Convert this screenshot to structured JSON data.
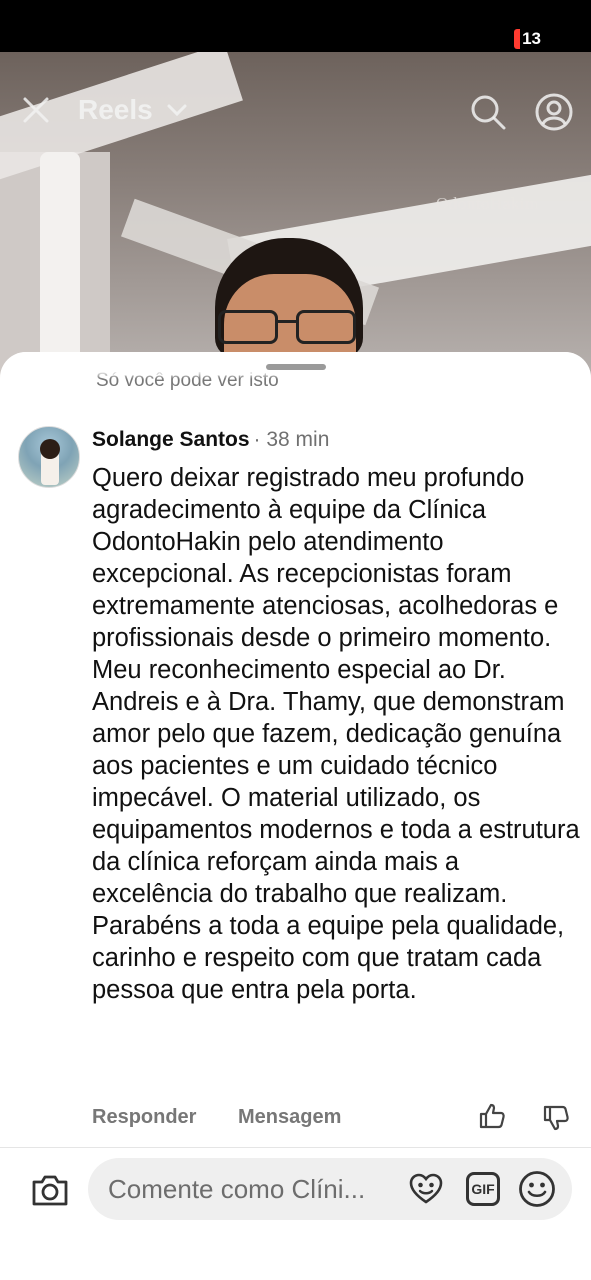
{
  "status_bar": {
    "battery_level": "13",
    "battery_color": "#ff3b30"
  },
  "video": {
    "header_title": "Reels",
    "brand_logo": "OdontoHakim",
    "icons": [
      "close-icon",
      "chevron-down-icon",
      "search-icon",
      "profile-icon"
    ]
  },
  "sheet": {
    "visibility_note": "Só você pode ver isto",
    "comment": {
      "author": "Solange Santos",
      "time": "· 38 min",
      "paragraphs": [
        "Quero deixar registrado meu profundo agradecimento à equipe da Clínica OdontoHakin pelo atendimento excepcional. As recepcionistas foram extremamente atenciosas, acolhedoras e profissionais desde o primeiro momento.",
        "Meu reconhecimento especial ao Dr. Andreis e à Dra. Thamy, que demonstram amor pelo que fazem, dedicação genuína aos pacientes e um cuidado técnico impecável. O material utilizado, os equipamentos modernos e toda a estrutura da clínica reforçam ainda mais a excelência do trabalho que realizam.",
        "Parabéns a toda a equipe pela qualidade, carinho e respeito com que tratam cada pessoa que entra pela porta."
      ],
      "reply_label": "Responder",
      "message_label": "Mensagem"
    },
    "composer": {
      "placeholder": "Comente como Clíni...",
      "gif_label": "GIF"
    }
  }
}
